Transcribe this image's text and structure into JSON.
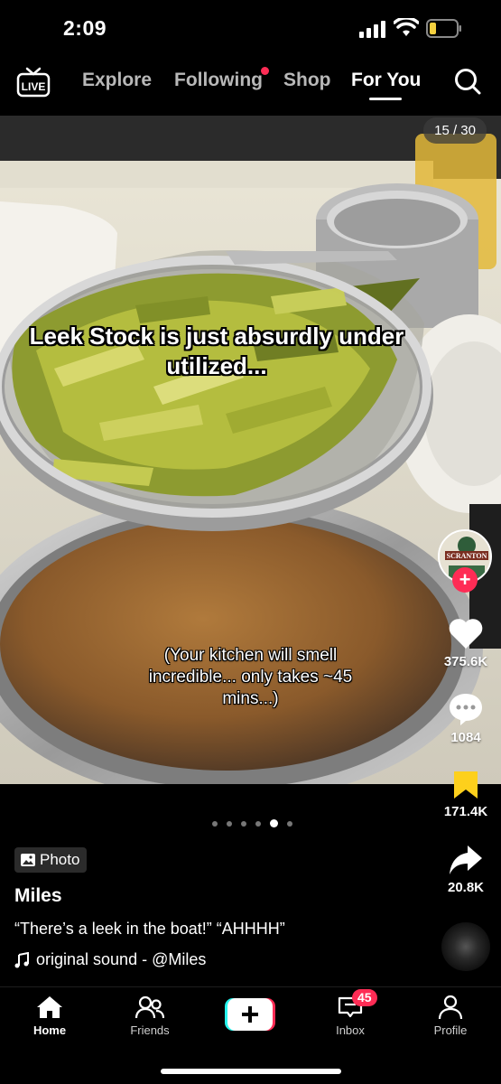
{
  "status_bar": {
    "time": "2:09"
  },
  "top_nav": {
    "live_label": "LIVE",
    "tabs": [
      {
        "label": "Explore"
      },
      {
        "label": "Following"
      },
      {
        "label": "Shop"
      },
      {
        "label": "For You"
      }
    ],
    "active_tab": "For You"
  },
  "post": {
    "photo_counter": "15 / 30",
    "caption_main": "Leek Stock is just absurdly under utilized...",
    "caption_sub": "(Your kitchen will smell incredible... only takes ~45 mins...)",
    "photo_badge": "Photo",
    "author": "Miles",
    "description": "“There’s a leek in the boat!” “AHHHH”",
    "sound": "original sound - @Miles",
    "carousel_dots": 6,
    "carousel_active_index": 4
  },
  "rail": {
    "avatar_text": "SCRANTON",
    "likes": "375.6K",
    "comments": "1084",
    "saves": "171.4K",
    "shares": "20.8K",
    "save_color": "#fdd01c",
    "accent_color": "#fe2c55"
  },
  "bottom_nav": {
    "home": "Home",
    "friends": "Friends",
    "inbox": "Inbox",
    "inbox_badge": "45",
    "profile": "Profile"
  }
}
